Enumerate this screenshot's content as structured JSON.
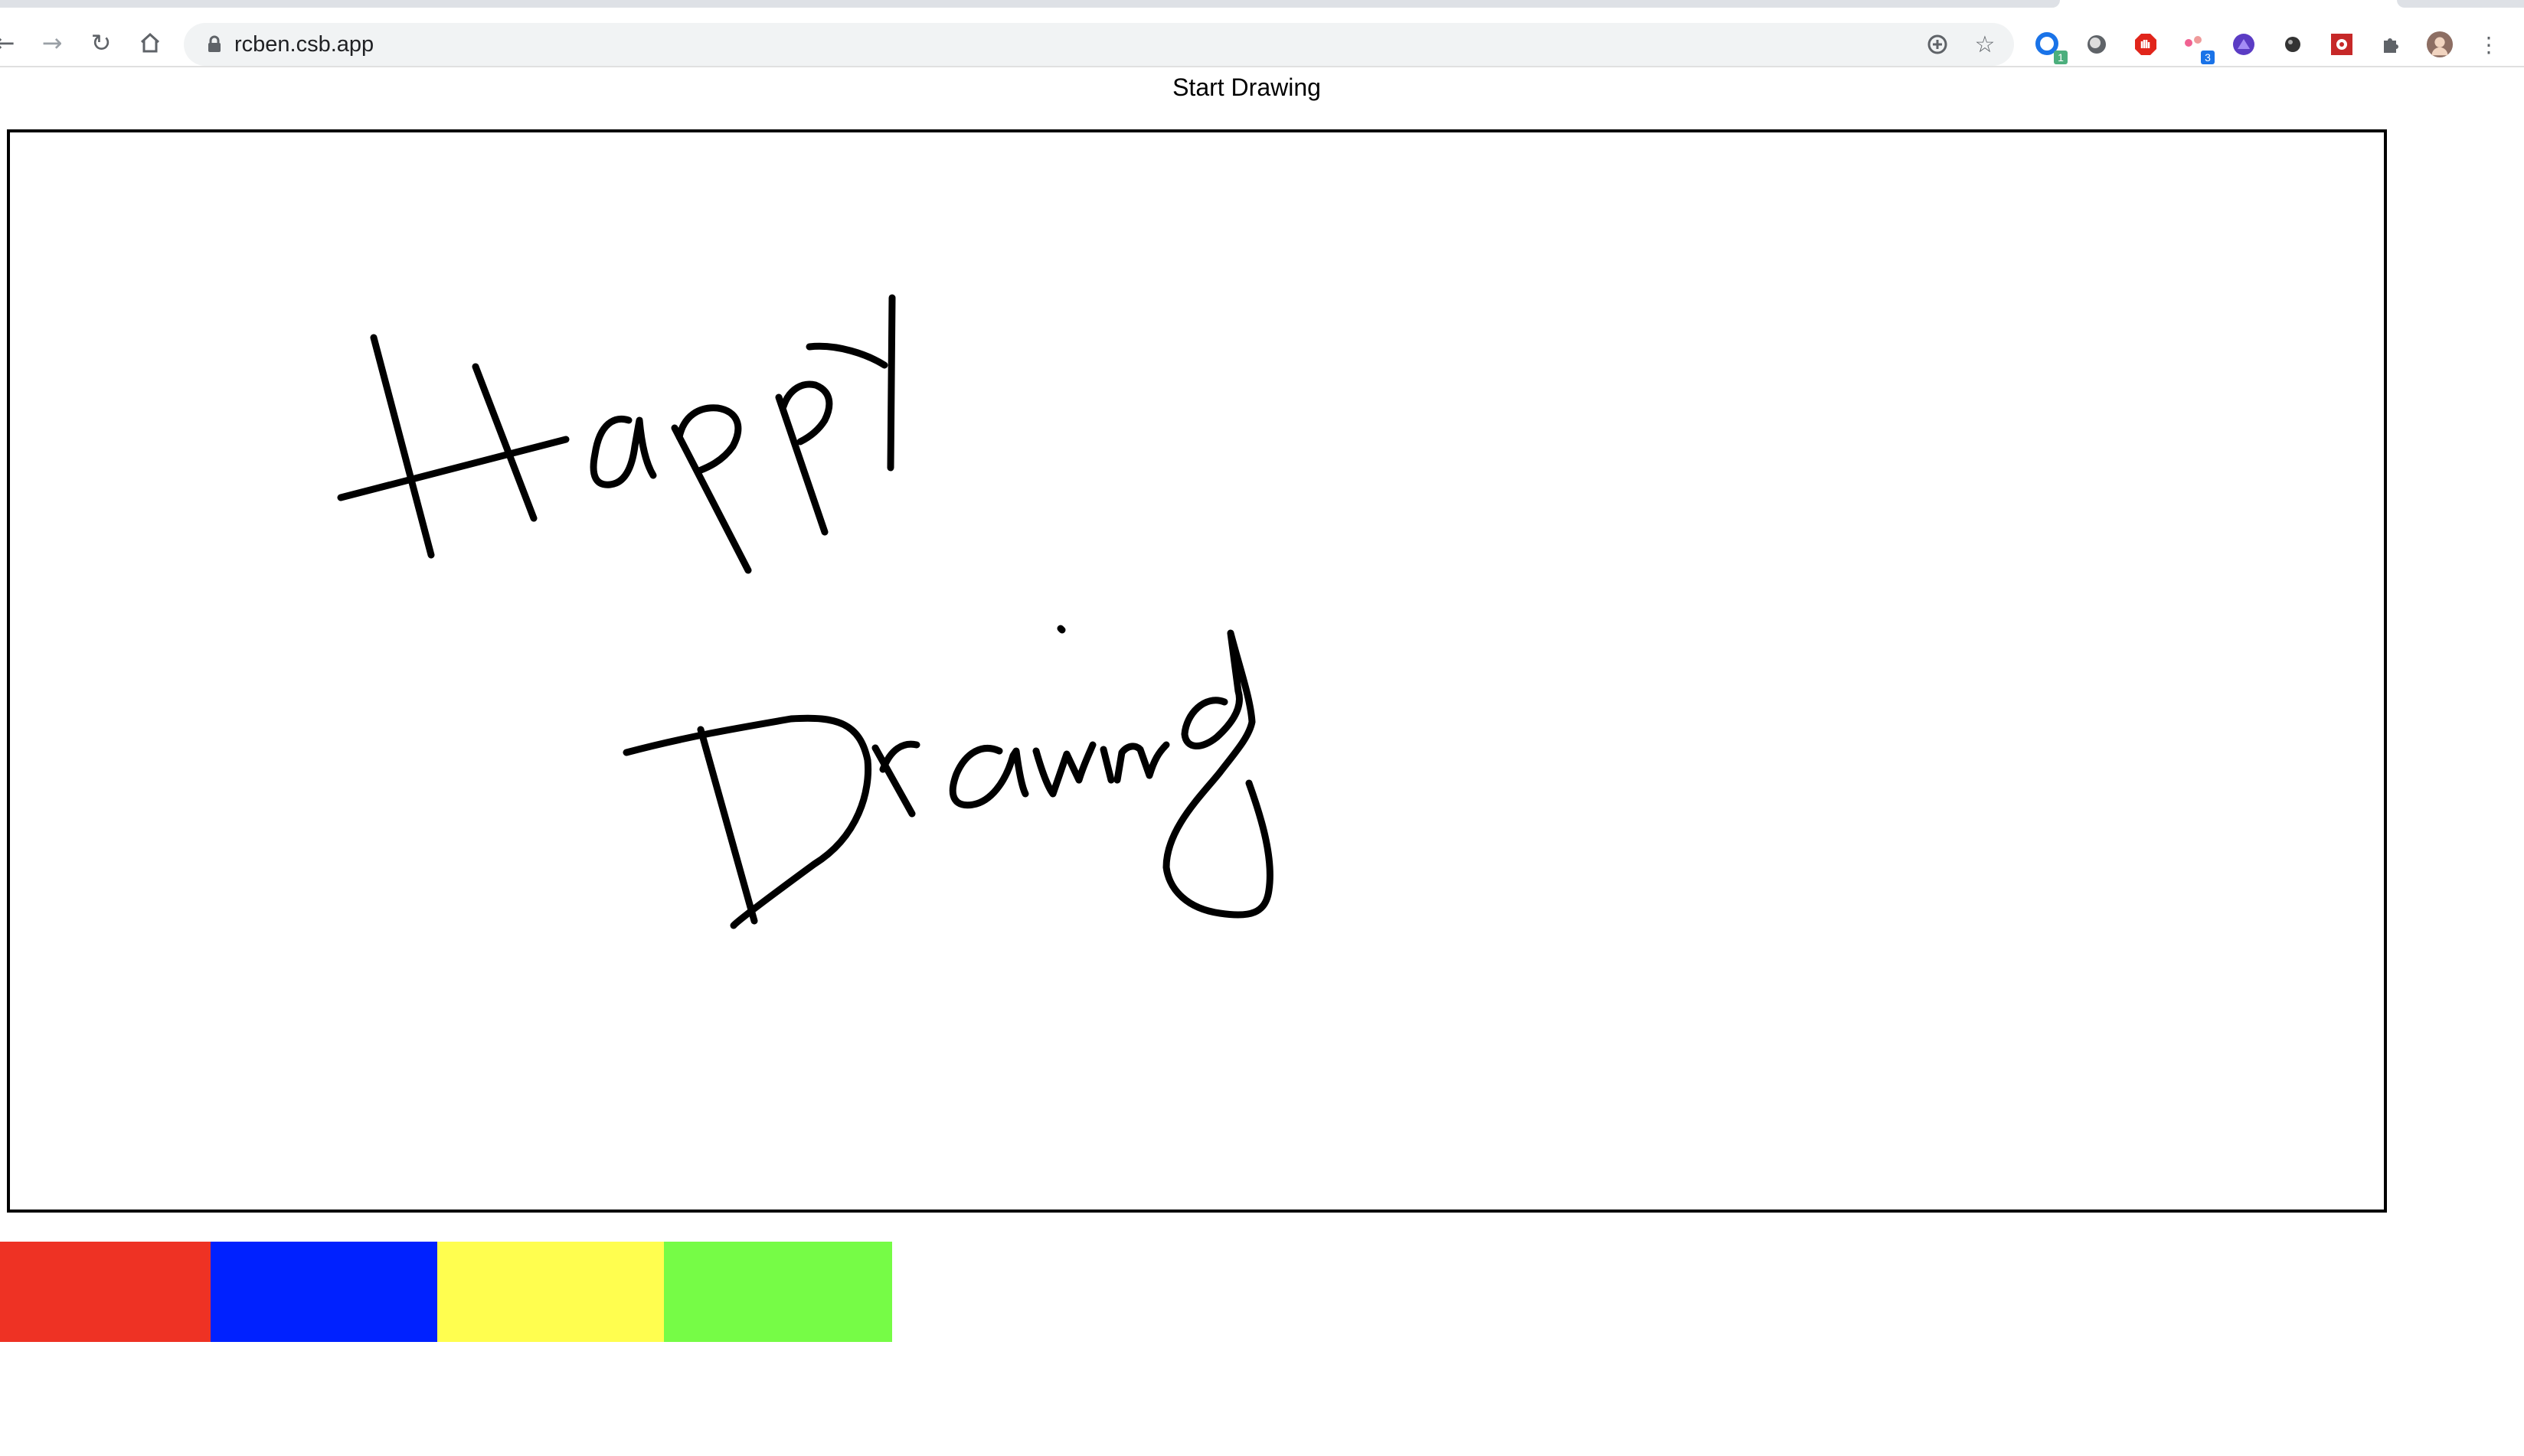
{
  "browser": {
    "url": "rcben.csb.app",
    "extensions": [
      {
        "name": "extension-1-icon",
        "badge": "1"
      },
      {
        "name": "extension-2-icon",
        "badge": ""
      },
      {
        "name": "extension-3-icon",
        "badge": ""
      },
      {
        "name": "extension-4-icon",
        "badge": "3"
      },
      {
        "name": "extension-5-icon",
        "badge": ""
      },
      {
        "name": "extension-6-icon",
        "badge": ""
      },
      {
        "name": "extension-7-icon",
        "badge": ""
      }
    ]
  },
  "page": {
    "title": "Start Drawing"
  },
  "canvas": {
    "stroke_color": "#000000",
    "drawing": "Happy Drawing"
  },
  "palette": {
    "colors": [
      {
        "name": "red",
        "hex": "#ee3224"
      },
      {
        "name": "blue",
        "hex": "#0021ff"
      },
      {
        "name": "yellow",
        "hex": "#fffe4f"
      },
      {
        "name": "green",
        "hex": "#76fc46"
      }
    ]
  }
}
